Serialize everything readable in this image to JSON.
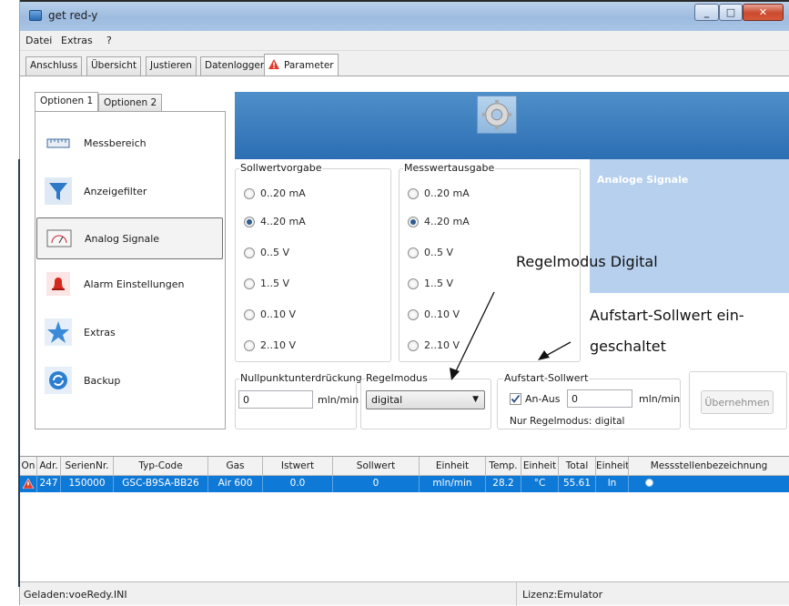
{
  "window": {
    "title": "get red-y"
  },
  "menu": {
    "items": [
      "Datei",
      "Extras",
      "?"
    ]
  },
  "tabs": [
    "Anschluss",
    "Übersicht",
    "Justieren",
    "Datenlogger",
    "Parameter"
  ],
  "option_tabs": [
    "Optionen 1",
    "Optionen 2"
  ],
  "nav": [
    {
      "label": "Messbereich",
      "icon": "ruler-icon"
    },
    {
      "label": "Anzeigefilter",
      "icon": "filter-funnel-icon"
    },
    {
      "label": "Analog Signale",
      "icon": "gauge-icon",
      "selected": true
    },
    {
      "label": "Alarm Einstellungen",
      "icon": "bell-icon"
    },
    {
      "label": "Extras",
      "icon": "star-icon"
    },
    {
      "label": "Backup",
      "icon": "backup-sync-icon"
    }
  ],
  "banner": {
    "icon": "gear-icon",
    "side_title": "Analoge Signale"
  },
  "sollwertvorgabe": {
    "title": "Sollwertvorgabe",
    "options": [
      "0..20 mA",
      "4..20 mA",
      "0..5  V",
      "1..5 V",
      "0..10  V",
      "2..10 V"
    ],
    "selected": "4..20 mA"
  },
  "messwertausgabe": {
    "title": "Messwertausgabe",
    "options": [
      "0..20 mA",
      "4..20 mA",
      "0..5  V",
      "1..5 V",
      "0..10  V",
      "2..10 V"
    ],
    "selected": "4..20 mA"
  },
  "nullpunkt": {
    "title": "Nullpunktunterdrückung",
    "value": "0",
    "unit": "mln/min"
  },
  "regelmodus": {
    "title": "Regelmodus",
    "value": "digital"
  },
  "aufstart": {
    "title": "Aufstart-Sollwert",
    "checkbox_label": "An-Aus",
    "checked": true,
    "value": "0",
    "unit": "mln/min",
    "note": "Nur Regelmodus: digital"
  },
  "apply_button": "Übernehmen",
  "annotations": {
    "regelmodus": "Regelmodus Digital",
    "aufstart_line1": "Aufstart-Sollwert ein-",
    "aufstart_line2": "geschaltet"
  },
  "table": {
    "headers": [
      "On",
      "Adr.",
      "SerienNr.",
      "Typ-Code",
      "Gas",
      "Istwert",
      "Sollwert",
      "Einheit",
      "Temp.",
      "Einheit",
      "Total",
      "Einheit",
      "Messstellenbezeichnung"
    ],
    "rows": [
      [
        "",
        "247",
        "150000",
        "GSC-B9SA-BB26",
        "Air 600",
        "0.0",
        "0",
        "mln/min",
        "28.2",
        "°C",
        "55.61",
        "ln",
        ""
      ]
    ]
  },
  "status": {
    "left": "Geladen:voeRedy.INI",
    "right": "Lizenz:Emulator"
  },
  "colors": {
    "banner": "#2b6eb3",
    "side_panel": "#b6d0ee",
    "selected_row": "#0e79d6"
  }
}
